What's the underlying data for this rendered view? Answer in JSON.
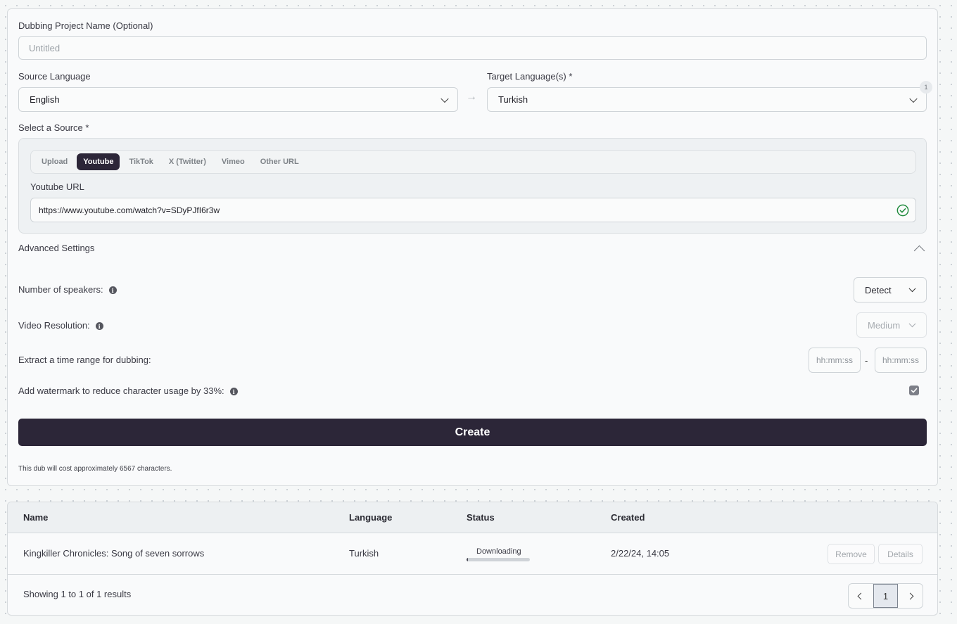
{
  "project": {
    "label": "Dubbing Project Name (Optional)",
    "placeholder": "Untitled",
    "value": ""
  },
  "source_language": {
    "label": "Source Language",
    "value": "English"
  },
  "arrow": "→",
  "target_language": {
    "label": "Target Language(s) *",
    "value": "Turkish",
    "count": "1"
  },
  "source": {
    "label": "Select a Source *",
    "tabs": [
      "Upload",
      "Youtube",
      "TikTok",
      "X (Twitter)",
      "Vimeo",
      "Other URL"
    ],
    "active_tab": "Youtube",
    "url_label": "Youtube URL",
    "url_value": "https://www.youtube.com/watch?v=SDyPJfI6r3w"
  },
  "advanced": {
    "title": "Advanced Settings",
    "speakers_label": "Number of speakers:",
    "speakers_value": "Detect",
    "resolution_label": "Video Resolution:",
    "resolution_value": "Medium",
    "time_range_label": "Extract a time range for dubbing:",
    "time_start_placeholder": "hh:mm:ss",
    "time_separator": "-",
    "time_end_placeholder": "hh:mm:ss",
    "watermark_label": "Add watermark to reduce character usage by 33%:",
    "watermark_checked": true
  },
  "create_label": "Create",
  "cost_text": "This dub will cost approximately 6567 characters.",
  "table": {
    "headers": {
      "name": "Name",
      "language": "Language",
      "status": "Status",
      "created": "Created"
    },
    "rows": [
      {
        "name": "Kingkiller Chronicles: Song of seven sorrows",
        "language": "Turkish",
        "status": "Downloading",
        "progress": 0.02,
        "created": "2/22/24, 14:05",
        "remove": "Remove",
        "details": "Details"
      }
    ],
    "footer": "Showing 1 to 1 of 1 results",
    "current_page": "1"
  },
  "colors": {
    "primary": "#2c2638",
    "success": "#1e8a3c"
  }
}
